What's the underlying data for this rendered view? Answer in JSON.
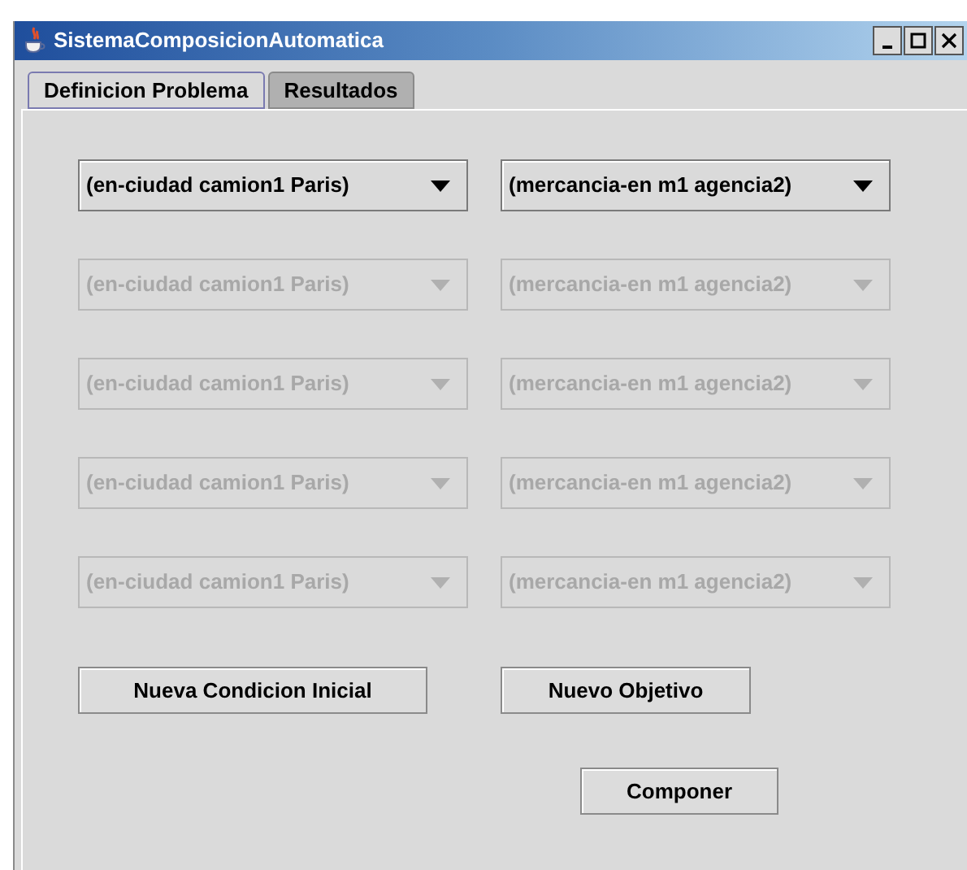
{
  "window": {
    "title": "SistemaComposicionAutomatica"
  },
  "tabs": [
    {
      "label": "Definicion Problema",
      "selected": true
    },
    {
      "label": "Resultados",
      "selected": false
    }
  ],
  "rows": [
    {
      "initial": {
        "value": "(en-ciudad camion1 Paris)",
        "disabled": false
      },
      "goal": {
        "value": "(mercancia-en m1 agencia2)",
        "disabled": false
      }
    },
    {
      "initial": {
        "value": "(en-ciudad camion1 Paris)",
        "disabled": true
      },
      "goal": {
        "value": "(mercancia-en m1 agencia2)",
        "disabled": true
      }
    },
    {
      "initial": {
        "value": "(en-ciudad camion1 Paris)",
        "disabled": true
      },
      "goal": {
        "value": "(mercancia-en m1 agencia2)",
        "disabled": true
      }
    },
    {
      "initial": {
        "value": "(en-ciudad camion1 Paris)",
        "disabled": true
      },
      "goal": {
        "value": "(mercancia-en m1 agencia2)",
        "disabled": true
      }
    },
    {
      "initial": {
        "value": "(en-ciudad camion1 Paris)",
        "disabled": true
      },
      "goal": {
        "value": "(mercancia-en m1 agencia2)",
        "disabled": true
      }
    }
  ],
  "buttons": {
    "new_initial": "Nueva Condicion Inicial",
    "new_goal": "Nuevo Objetivo",
    "compose": "Componer"
  }
}
